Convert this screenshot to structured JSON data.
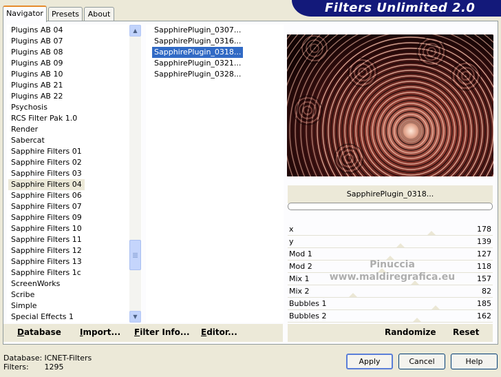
{
  "tabs": [
    {
      "label": "Navigator",
      "active": true
    },
    {
      "label": "Presets",
      "active": false
    },
    {
      "label": "About",
      "active": false
    }
  ],
  "banner": {
    "title": "Filters Unlimited 2.0",
    "color": "#13197a"
  },
  "categories": {
    "items": [
      "Plugins AB 04",
      "Plugins AB 07",
      "Plugins AB 08",
      "Plugins AB 09",
      "Plugins AB 10",
      "Plugins AB 21",
      "Plugins AB 22",
      "Psychosis",
      "RCS Filter Pak 1.0",
      "Render",
      "Sabercat",
      "Sapphire Filters 01",
      "Sapphire Filters 02",
      "Sapphire Filters 03",
      "Sapphire Filters 04",
      "Sapphire Filters 06",
      "Sapphire Filters 07",
      "Sapphire Filters 09",
      "Sapphire Filters 10",
      "Sapphire Filters 11",
      "Sapphire Filters 12",
      "Sapphire Filters 13",
      "Sapphire Filters 1c",
      "ScreenWorks",
      "Scribe",
      "Simple",
      "Special Effects 1"
    ],
    "selected": "Sapphire Filters 04"
  },
  "filters": {
    "items": [
      "SapphirePlugin_0307...",
      "SapphirePlugin_0316...",
      "SapphirePlugin_0318...",
      "SapphirePlugin_0321...",
      "SapphirePlugin_0328..."
    ],
    "selected": "SapphirePlugin_0318...",
    "selected_color": "#316ac5"
  },
  "preview": {
    "filter_name": "SapphirePlugin_0318..."
  },
  "parameters": [
    {
      "name": "x",
      "value": "178",
      "level": 0.7
    },
    {
      "name": "y",
      "value": "139",
      "level": 0.55
    },
    {
      "name": "Mod 1",
      "value": "127",
      "level": 0.5
    },
    {
      "name": "Mod 2",
      "value": "118",
      "level": 0.46
    },
    {
      "name": "Mix 1",
      "value": "157",
      "level": 0.62
    },
    {
      "name": "Mix 2",
      "value": "82",
      "level": 0.32
    },
    {
      "name": "Bubbles 1",
      "value": "185",
      "level": 0.72
    },
    {
      "name": "Bubbles 2",
      "value": "162",
      "level": 0.63
    }
  ],
  "toolbar": {
    "database": "Database",
    "import": "Import...",
    "filter_info": "Filter Info...",
    "editor": "Editor...",
    "randomize": "Randomize",
    "reset": "Reset"
  },
  "footer": {
    "database_label": "Database:",
    "database_value": "ICNET-Filters",
    "filters_label": "Filters:",
    "filters_value": "1295"
  },
  "buttons": {
    "apply": "Apply",
    "cancel": "Cancel",
    "help": "Help"
  },
  "watermark": {
    "line1": "Pinuccia",
    "line2": "www.maldiregrafica.eu"
  }
}
